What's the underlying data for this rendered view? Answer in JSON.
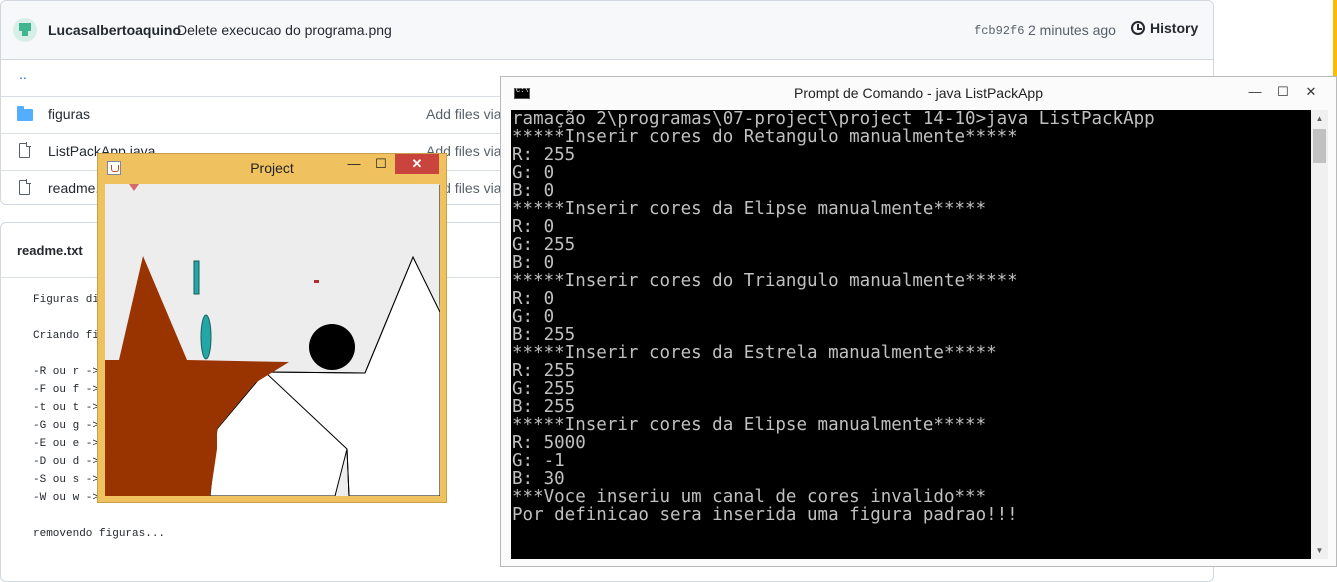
{
  "github": {
    "commit": {
      "author": "Lucasalbertoaquino",
      "message": "Delete execucao do programa.png",
      "sha": "fcb92f6",
      "time": "2 minutes ago",
      "history_label": "History"
    },
    "up_dir": "..",
    "files": [
      {
        "name": "figuras",
        "type": "folder",
        "commit_message": "Add files via"
      },
      {
        "name": "ListPackApp.java",
        "type": "file",
        "commit_message": "Add files via"
      },
      {
        "name": "readme.",
        "type": "file",
        "commit_message": "Add files via"
      }
    ],
    "readme": {
      "title": "readme.txt",
      "lines": [
        "Figuras di",
        "Criando fi",
        "-R ou r ->",
        "-F ou f ->",
        "-t ou t ->",
        "-G ou g ->",
        "-E ou e ->",
        "-D ou d ->",
        "-S ou s ->",
        "-W ou w ->",
        "removendo figuras..."
      ]
    }
  },
  "project_window": {
    "title": "Project",
    "minimize": "—",
    "maximize": "☐",
    "close": "✕",
    "colors": {
      "frame": "#f0c25f",
      "canvas": "#ededed",
      "brown": "#993300",
      "teal": "#23a6a6",
      "black": "#000000",
      "white": "#ffffff"
    }
  },
  "cmd_window": {
    "title": "Prompt de Comando - java  ListPackApp",
    "minimize": "—",
    "maximize": "☐",
    "close": "✕",
    "lines": [
      "ramação 2\\programas\\07-project\\project 14-10>java ListPackApp",
      "*****Inserir cores do Retangulo manualmente*****",
      "R: 255",
      "G: 0",
      "B: 0",
      "*****Inserir cores da Elipse manualmente*****",
      "R: 0",
      "G: 255",
      "B: 0",
      "*****Inserir cores do Triangulo manualmente*****",
      "R: 0",
      "G: 0",
      "B: 255",
      "*****Inserir cores da Estrela manualmente*****",
      "R: 255",
      "G: 255",
      "B: 255",
      "*****Inserir cores da Elipse manualmente*****",
      "R: 5000",
      "G: -1",
      "B: 30",
      "***Voce inseriu um canal de cores invalido***",
      "Por definicao sera inserida uma figura padrao!!!"
    ]
  }
}
